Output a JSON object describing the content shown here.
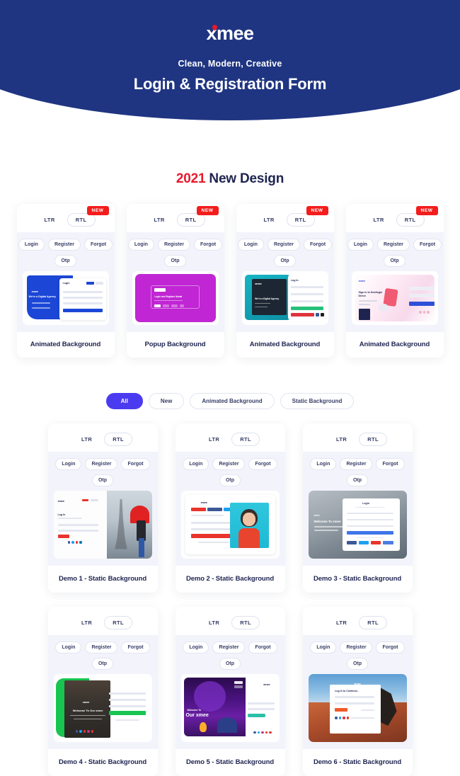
{
  "header": {
    "logo": "xmee",
    "subtitle": "Clean, Modern, Creative",
    "title": "Login & Registration Form",
    "bg_color": "#1f3582",
    "accent_dot_color": "#e8192c"
  },
  "section": {
    "year": "2021",
    "rest": " New Design"
  },
  "card_labels": {
    "badge_new": "NEW",
    "tab_ltr": "LTR",
    "tab_rtl": "RTL",
    "pill_login": "Login",
    "pill_register": "Register",
    "pill_forgot": "Forgot",
    "pill_otp": "Otp"
  },
  "new_designs": [
    {
      "caption": "Animated Background",
      "badge": "NEW",
      "preview": "blue-agency",
      "accent": "#1b46d6"
    },
    {
      "caption": "Popup Background",
      "badge": "NEW",
      "preview": "magenta-popup",
      "accent": "#c026d3"
    },
    {
      "caption": "Animated Background",
      "badge": "NEW",
      "preview": "teal-icecream",
      "accent": "#16b4c4"
    },
    {
      "caption": "Animated Background",
      "badge": "NEW",
      "preview": "pink-illustration",
      "accent": "#f7d9ec"
    }
  ],
  "filters": [
    {
      "label": "All",
      "active": true
    },
    {
      "label": "New",
      "active": false
    },
    {
      "label": "Animated Background",
      "active": false
    },
    {
      "label": "Static Background",
      "active": false
    }
  ],
  "demos": [
    {
      "caption": "Demo 1 - Static Background",
      "preview": "eiffel-umbrella",
      "accent": "#e02222"
    },
    {
      "caption": "Demo 2 - Static Background",
      "preview": "cyan-portrait",
      "accent": "#e8442e"
    },
    {
      "caption": "Demo 3 - Static Background",
      "preview": "grey-water",
      "accent": "#4a7fe0"
    },
    {
      "caption": "Demo 4 - Static Background",
      "preview": "green-mountain",
      "accent": "#18c551"
    },
    {
      "caption": "Demo 5 - Static Background",
      "preview": "purple-camping",
      "accent": "#2bbfa8"
    },
    {
      "caption": "Demo 6 - Static Background",
      "preview": "biker-canyon",
      "accent": "#f05a28"
    }
  ],
  "preview_text": {
    "p1_logo": "xmee",
    "p1_tag": "We're a Digital Agency",
    "p1_form": "Login",
    "p2_modal_title": "Login and Register Modal",
    "p3_logo": "xmee",
    "p3_tag": "We're a Digital Agency",
    "p3_form": "Log In",
    "p4_logo": "xmee",
    "p4_title": "Sign in to Nextlogin Direct",
    "d1_form": "Log In",
    "d2_logo": "xmee",
    "d3_title": "Welcome To xmee",
    "d3_form": "Login",
    "d4_title": "Welcome To Our xmee",
    "d5_pre": "Welcome To",
    "d5_title": "Our xmee",
    "d5_logo": "xmee",
    "d6_logo": "xmee",
    "d6_form": "Log in to Continue.."
  }
}
